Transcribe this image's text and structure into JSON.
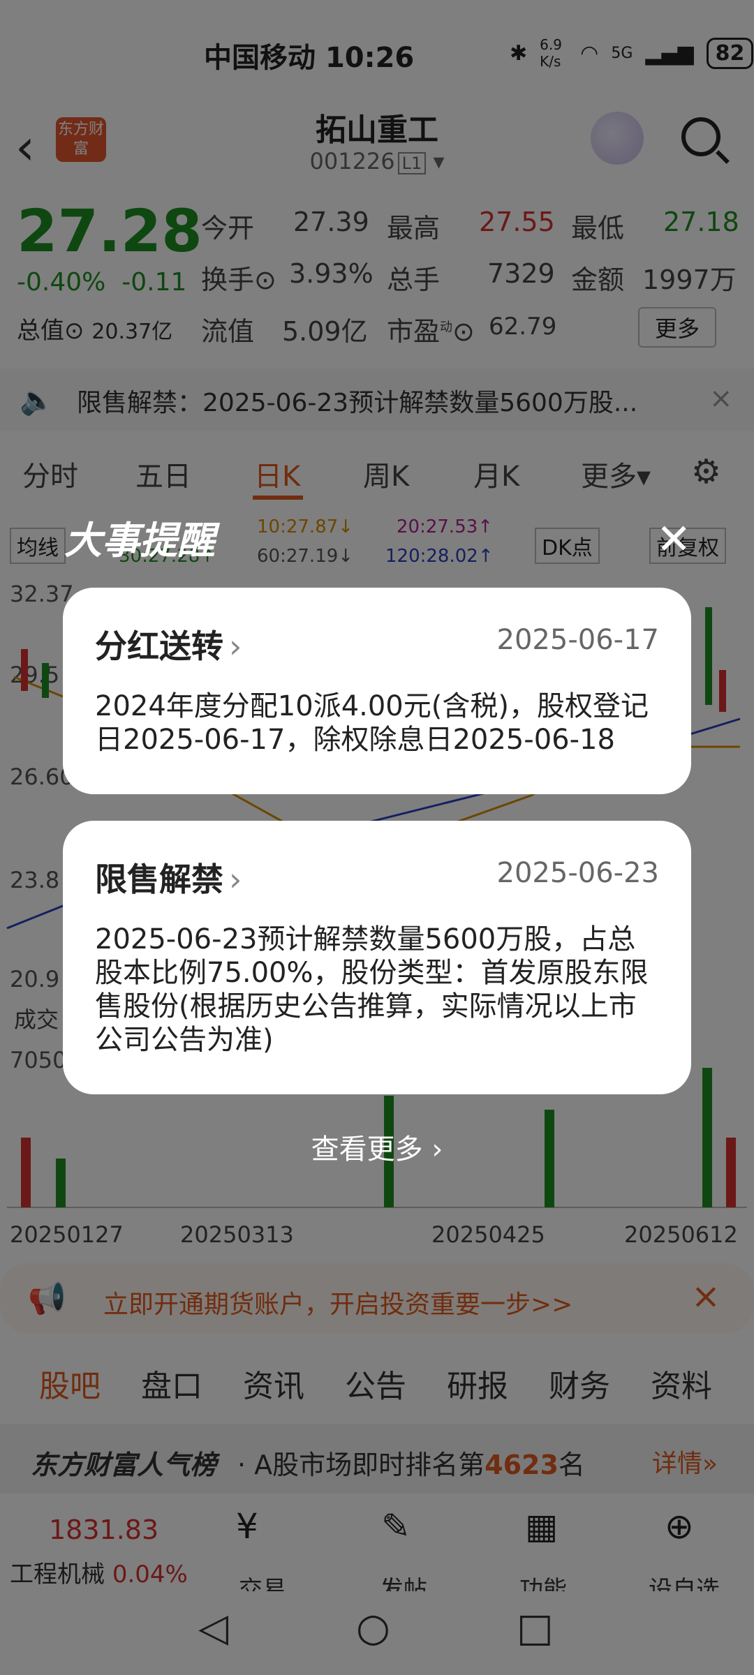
{
  "status": {
    "carrier": "中国移动",
    "time": "10:26",
    "speed": "6.9 K/s",
    "net": "5G",
    "battery": "82"
  },
  "header": {
    "title": "拓山重工",
    "code": "001226",
    "level": "L1",
    "logo": "东方财富"
  },
  "quote": {
    "price": "27.28",
    "change_pct": "-0.40%",
    "change": "-0.11",
    "mcap_label": "总值",
    "mcap": "20.37亿",
    "open_label": "今开",
    "open": "27.39",
    "high_label": "最高",
    "high": "27.55",
    "low_label": "最低",
    "low": "27.18",
    "turnover_label": "换手",
    "turnover": "3.93%",
    "vol_label": "总手",
    "vol": "7329",
    "amount_label": "金额",
    "amount": "1997万",
    "float_label": "流值",
    "float": "5.09亿",
    "pe_label": "市盈",
    "pe_sup": "动",
    "pe": "62.79",
    "more": "更多"
  },
  "notice": {
    "text": "限售解禁：2025-06-23预计解禁数量5600万股..."
  },
  "tabs": [
    "分时",
    "五日",
    "日K",
    "周K",
    "月K",
    "更多"
  ],
  "chart": {
    "ma_label": "均线",
    "ma10": "10:27.87↓",
    "ma20": "20:27.53↑",
    "ma30": "30:27.28↑",
    "ma60": "60:27.19↓",
    "ma120": "120:28.02↑",
    "dk": "DK点",
    "adjust": "前复权",
    "y1": "32.37",
    "y2": "29.5",
    "y3": "26.60",
    "y4": "23.8",
    "y5": "20.9",
    "vol_label": "成交",
    "vol_val": "7050",
    "dates": [
      "20250127",
      "20250313",
      "20250425",
      "20250612"
    ]
  },
  "promo": {
    "text": "立即开通期货账户，开启投资重要一步>>"
  },
  "subtabs": [
    "股吧",
    "盘口",
    "资讯",
    "公告",
    "研报",
    "财务",
    "资料"
  ],
  "rank": {
    "brand": "东方财富人气榜",
    "text_pre": "· A股市场即时排名第",
    "rank": "4623",
    "text_post": "名",
    "detail": "详情"
  },
  "dock": {
    "index_val": "1831.83",
    "index_name": "工程机械",
    "index_chg": "0.04%",
    "trade": "交易",
    "post": "发帖",
    "func": "功能",
    "watch": "设自选"
  },
  "popup": {
    "title": "大事提醒",
    "cards": [
      {
        "title": "分红送转",
        "date": "2025-06-17",
        "body": "2024年度分配10派4.00元(含税)，股权登记日2025-06-17，除权除息日2025-06-18"
      },
      {
        "title": "限售解禁",
        "date": "2025-06-23",
        "body": "2025-06-23预计解禁数量5600万股，占总股本比例75.00%，股份类型：首发原股东限售股份(根据历史公告推算，实际情况以上市公司公告为准)"
      }
    ],
    "view_more": "查看更多"
  }
}
